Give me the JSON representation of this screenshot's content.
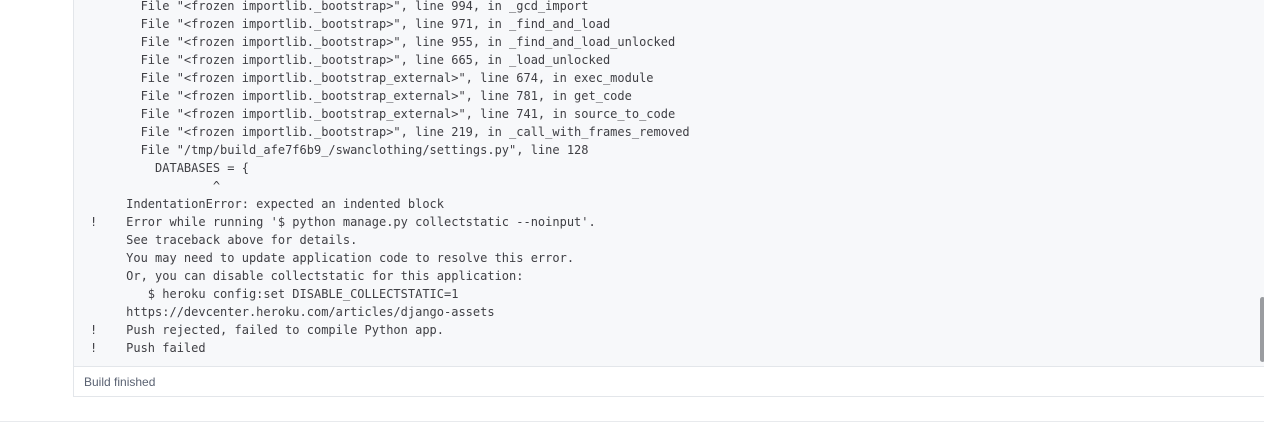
{
  "build_log": {
    "lines": [
      {
        "bang": "",
        "text": "       File \"<frozen importlib._bootstrap>\", line 994, in _gcd_import"
      },
      {
        "bang": "",
        "text": "       File \"<frozen importlib._bootstrap>\", line 971, in _find_and_load"
      },
      {
        "bang": "",
        "text": "       File \"<frozen importlib._bootstrap>\", line 955, in _find_and_load_unlocked"
      },
      {
        "bang": "",
        "text": "       File \"<frozen importlib._bootstrap>\", line 665, in _load_unlocked"
      },
      {
        "bang": "",
        "text": "       File \"<frozen importlib._bootstrap_external>\", line 674, in exec_module"
      },
      {
        "bang": "",
        "text": "       File \"<frozen importlib._bootstrap_external>\", line 781, in get_code"
      },
      {
        "bang": "",
        "text": "       File \"<frozen importlib._bootstrap_external>\", line 741, in source_to_code"
      },
      {
        "bang": "",
        "text": "       File \"<frozen importlib._bootstrap>\", line 219, in _call_with_frames_removed"
      },
      {
        "bang": "",
        "text": "       File \"/tmp/build_afe7f6b9_/swanclothing/settings.py\", line 128"
      },
      {
        "bang": "",
        "text": "         DATABASES = {"
      },
      {
        "bang": "",
        "text": "                 ^"
      },
      {
        "bang": "",
        "text": "     IndentationError: expected an indented block"
      },
      {
        "bang": "!",
        "text": "     Error while running '$ python manage.py collectstatic --noinput'."
      },
      {
        "bang": "",
        "text": "     See traceback above for details."
      },
      {
        "bang": "",
        "text": "     You may need to update application code to resolve this error."
      },
      {
        "bang": "",
        "text": "     Or, you can disable collectstatic for this application:"
      },
      {
        "bang": "",
        "text": "        $ heroku config:set DISABLE_COLLECTSTATIC=1"
      },
      {
        "bang": "",
        "text": "     https://devcenter.heroku.com/articles/django-assets"
      },
      {
        "bang": "!",
        "text": "     Push rejected, failed to compile Python app."
      },
      {
        "bang": "!",
        "text": "     Push failed"
      }
    ],
    "status": "Build finished"
  },
  "colors": {
    "log_background": "#f7f8fa",
    "log_text": "#3f3f44",
    "status_text": "#5a6272",
    "border": "#e3e6ea"
  }
}
